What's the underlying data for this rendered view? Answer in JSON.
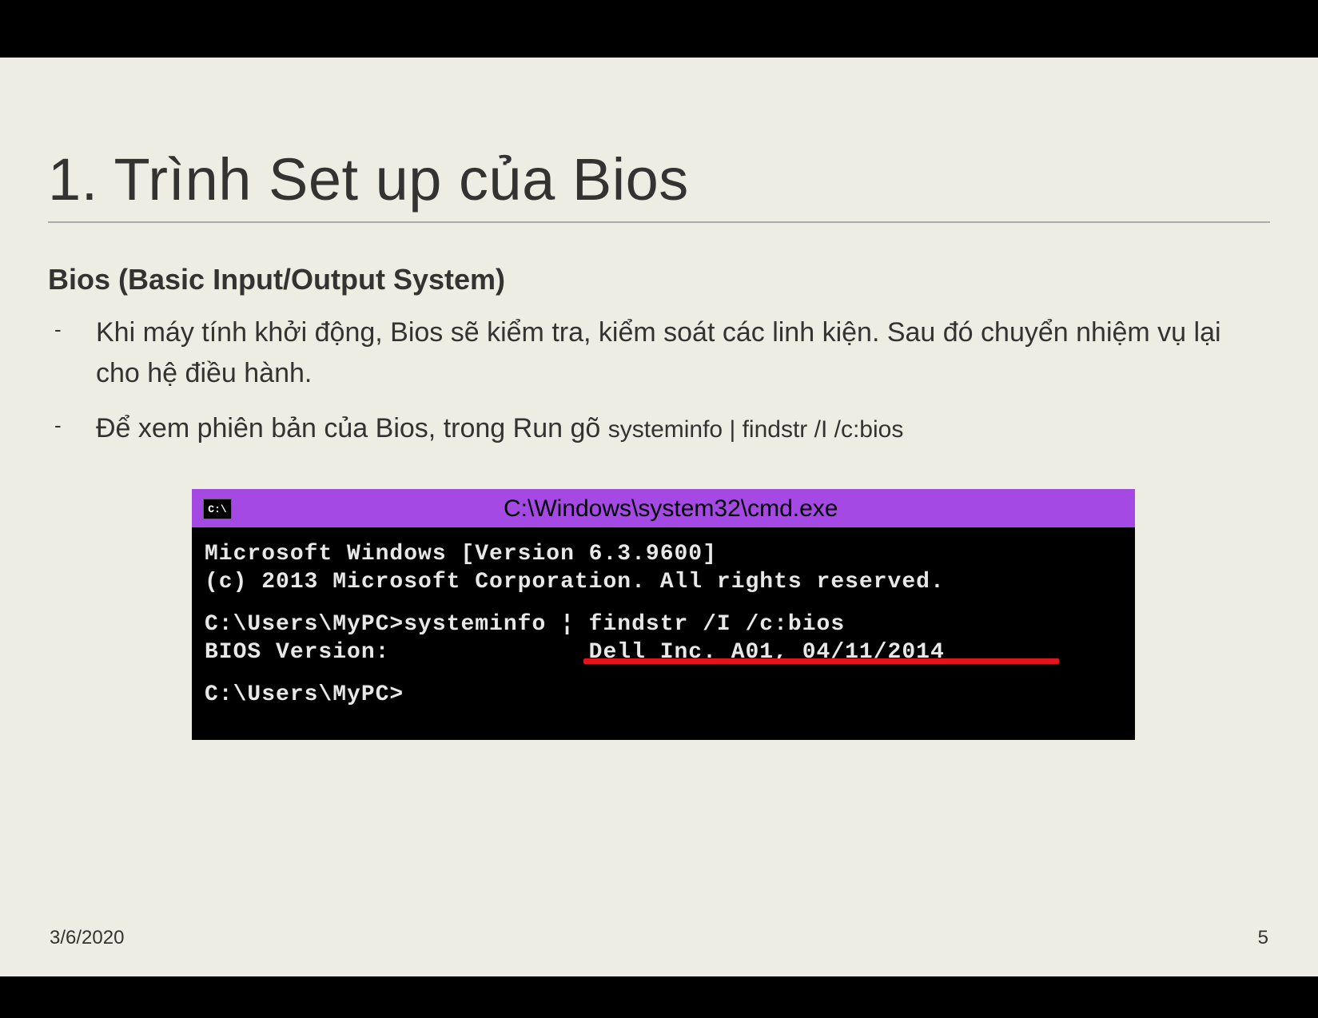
{
  "header": {
    "title": "1. Trình Set up của Bios"
  },
  "content": {
    "subtitle": "Bios (Basic Input/Output System)",
    "bullets": [
      "Khi máy tính khởi động, Bios sẽ kiểm tra, kiểm soát các linh kiện. Sau đó chuyển nhiệm vụ lại cho hệ điều hành.",
      "Để xem phiên bản của Bios, trong Run gõ"
    ],
    "command_inline": "systeminfo | findstr /I /c:bios"
  },
  "terminal": {
    "icon_label": "C:\\",
    "title": "C:\\Windows\\system32\\cmd.exe",
    "lines": {
      "l1": "Microsoft Windows [Version 6.3.9600]",
      "l2": "(c) 2013 Microsoft Corporation. All rights reserved.",
      "l3": "C:\\Users\\MyPC>systeminfo ¦ findstr /I /c:bios",
      "l4": "BIOS Version:              Dell Inc. A01, 04/11/2014",
      "l5": "C:\\Users\\MyPC>"
    }
  },
  "footer": {
    "date": "3/6/2020",
    "page": "5"
  },
  "colors": {
    "slide_bg": "#eeede3",
    "titlebar_bg": "#a449e4",
    "underline_red": "#e3141b"
  }
}
